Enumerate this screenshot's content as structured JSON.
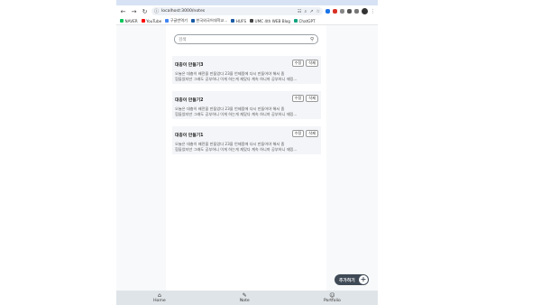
{
  "browser": {
    "url": "localhost:3000/notes",
    "bookmarks": [
      {
        "label": "NAVER",
        "color": "#03c75a"
      },
      {
        "label": "YouTube",
        "color": "#ff0000"
      },
      {
        "label": "구글번역기",
        "color": "#4285f4"
      },
      {
        "label": "한국외국어대학교...",
        "color": "#1a5aa6"
      },
      {
        "label": "HUFS",
        "color": "#1a5aa6"
      },
      {
        "label": "UMC 4th WEB Blog",
        "color": "#444444"
      },
      {
        "label": "ChatGPT",
        "color": "#10a37f"
      }
    ]
  },
  "search": {
    "placeholder": "검색"
  },
  "buttons": {
    "edit": "수정",
    "delete": "삭제"
  },
  "notes": [
    {
      "title": "대충이 만들기3",
      "body_line1": "오늘은 대충이 배전을 만들었다 23을 언제쯤에 다시 만들어야 해서 좀",
      "body_line2": "힘들었지만 그래도 공부하니 이게 하는게 재밌다 계속 하니까 공부하니 재밌..."
    },
    {
      "title": "대충이 만들기2",
      "body_line1": "오늘은 대충이 배전을 만들었다 23을 언제쯤에 다시 만들어야 해서 좀",
      "body_line2": "힘들었지만 그래도 공부하니 이게 하는게 재밌다 계속 하니까 공부하니 재밌..."
    },
    {
      "title": "대충이 만들기1",
      "body_line1": "오늘은 대충이 배전을 만들었다 23을 언제쯤에 다시 만들어야 해서 좀",
      "body_line2": "힘들었지만 그래도 공부하니 이게 하는게 재밌다 계속 하니까 공부하니 재밌..."
    }
  ],
  "fab": {
    "label": "추가하기",
    "icon": "+"
  },
  "nav": [
    {
      "label": "Home",
      "icon": "home-icon"
    },
    {
      "label": "Note",
      "icon": "edit-icon"
    },
    {
      "label": "Portfolio",
      "icon": "person-icon"
    }
  ]
}
